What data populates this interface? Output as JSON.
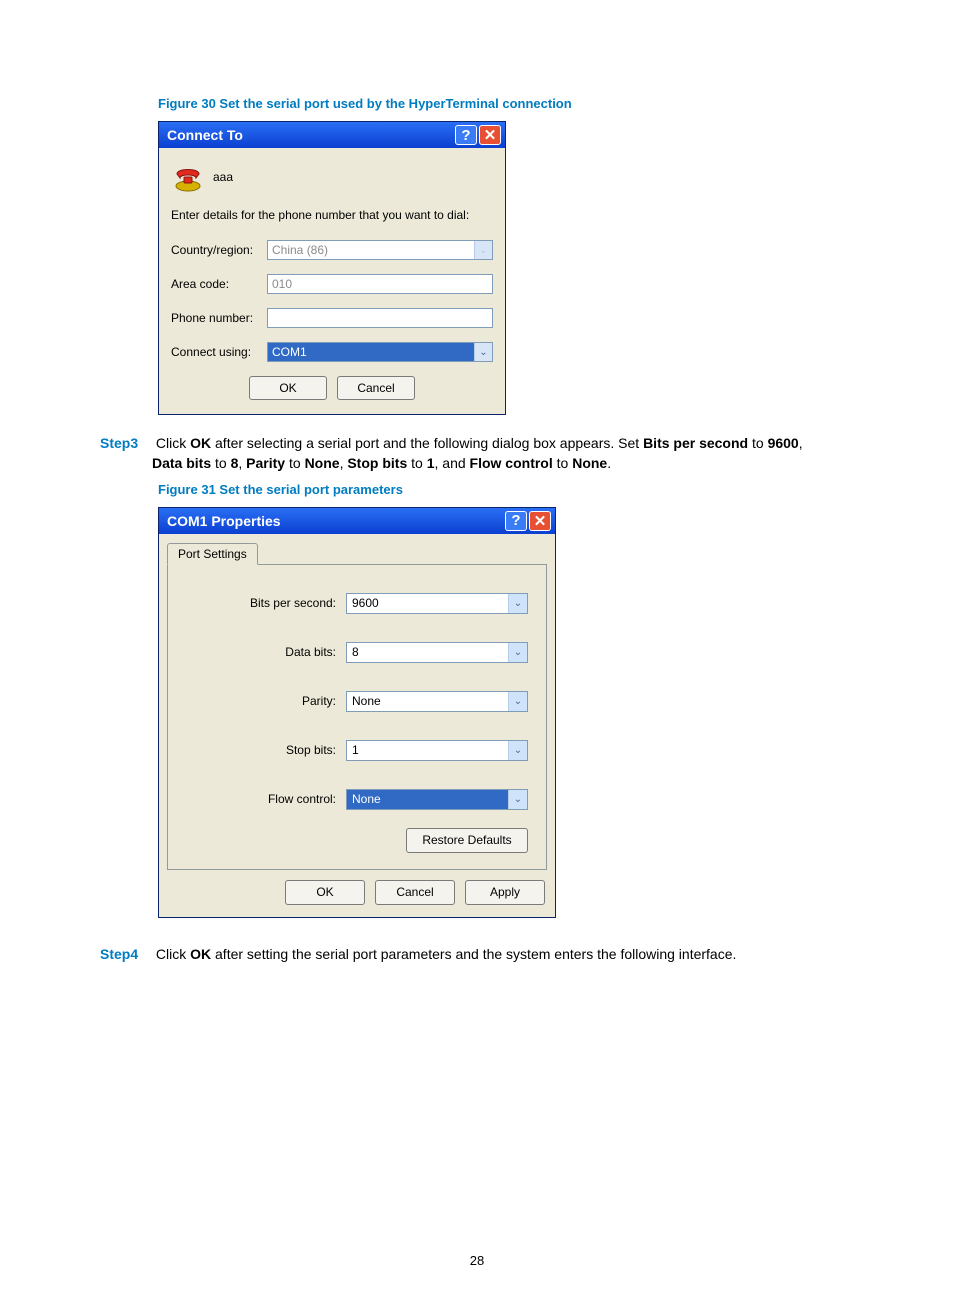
{
  "figure30_caption": "Figure 30 Set the serial port used by the HyperTerminal connection",
  "dialog1": {
    "title": "Connect To",
    "icon_label": "aaa",
    "prompt": "Enter details for the phone number that you want to dial:",
    "country_label": "Country/region:",
    "country_value": "China (86)",
    "area_label": "Area code:",
    "area_value": "010",
    "phone_label": "Phone number:",
    "phone_value": "",
    "connect_label": "Connect using:",
    "connect_value": "COM1",
    "ok": "OK",
    "cancel": "Cancel"
  },
  "step3": {
    "label": "Step3",
    "text_1": "Click ",
    "b1": "OK",
    "text_2": " after selecting a serial port and the following dialog box appears. Set ",
    "b2": "Bits per second",
    "text_3": " to ",
    "b3": "9600",
    "text_4": ", ",
    "b4": "Data bits",
    "text_5": " to ",
    "b5": "8",
    "text_6": ", ",
    "b6": "Parity",
    "text_7": " to ",
    "b7": "None",
    "text_8": ", ",
    "b8": "Stop bits",
    "text_9": " to ",
    "b9": "1",
    "text_10": ", and ",
    "b10": "Flow control",
    "text_11": " to ",
    "b11": "None",
    "text_12": "."
  },
  "figure31_caption": "Figure 31 Set the serial port parameters",
  "dialog2": {
    "title": "COM1 Properties",
    "tab": "Port Settings",
    "bps_label": "Bits per second:",
    "bps_value": "9600",
    "databits_label": "Data bits:",
    "databits_value": "8",
    "parity_label": "Parity:",
    "parity_value": "None",
    "stopbits_label": "Stop bits:",
    "stopbits_value": "1",
    "flow_label": "Flow control:",
    "flow_value": "None",
    "restore": "Restore Defaults",
    "ok": "OK",
    "cancel": "Cancel",
    "apply": "Apply"
  },
  "step4": {
    "label": "Step4",
    "text_1": "Click ",
    "b1": "OK",
    "text_2": " after setting the serial port parameters and the system enters the following interface."
  },
  "page_number": "28"
}
